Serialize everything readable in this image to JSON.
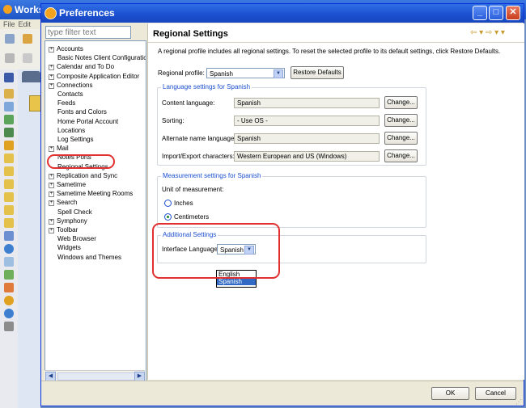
{
  "background_app": {
    "title": "Worksp",
    "menu": [
      "File",
      "Edit"
    ]
  },
  "window": {
    "title": "Preferences",
    "controls": [
      "_",
      "□",
      "✕"
    ]
  },
  "filter": {
    "placeholder": "type filter text"
  },
  "tree": [
    {
      "label": "Accounts",
      "expandable": true
    },
    {
      "label": "Basic Notes Client Configuratior",
      "expandable": false
    },
    {
      "label": "Calendar and To Do",
      "expandable": true
    },
    {
      "label": "Composite Application Editor",
      "expandable": true
    },
    {
      "label": "Connections",
      "expandable": true
    },
    {
      "label": "Contacts",
      "expandable": false
    },
    {
      "label": "Feeds",
      "expandable": false
    },
    {
      "label": "Fonts and Colors",
      "expandable": false
    },
    {
      "label": "Home Portal Account",
      "expandable": false
    },
    {
      "label": "Locations",
      "expandable": false
    },
    {
      "label": "Log Settings",
      "expandable": false
    },
    {
      "label": "Mail",
      "expandable": true
    },
    {
      "label": "Notes Ports",
      "expandable": false
    },
    {
      "label": "Regional Settings",
      "expandable": false
    },
    {
      "label": "Replication and Sync",
      "expandable": true
    },
    {
      "label": "Sametime",
      "expandable": true
    },
    {
      "label": "Sametime Meeting Rooms",
      "expandable": true
    },
    {
      "label": "Search",
      "expandable": true
    },
    {
      "label": "Spell Check",
      "expandable": false
    },
    {
      "label": "Symphony",
      "expandable": true
    },
    {
      "label": "Toolbar",
      "expandable": true
    },
    {
      "label": "Web Browser",
      "expandable": false
    },
    {
      "label": "Widgets",
      "expandable": false
    },
    {
      "label": "Windows and Themes",
      "expandable": false
    }
  ],
  "page": {
    "title": "Regional Settings",
    "nav_arrows": "⇦ ▾ ⇨ ▾ ▾",
    "description": "A regional profile includes all regional settings.  To reset the selected profile to its default settings, click Restore Defaults.",
    "profile_label": "Regional profile:",
    "profile_value": "Spanish",
    "restore_label": "Restore Defaults"
  },
  "language_group": {
    "title": "Language settings for Spanish",
    "change_label": "Change...",
    "rows": [
      {
        "label": "Content language:",
        "value": "Spanish"
      },
      {
        "label": "Sorting:",
        "value": "- Use OS -"
      },
      {
        "label": "Alternate name language:",
        "value": "Spanish"
      },
      {
        "label": "Import/Export characters:",
        "value": "Western European and US (Windows)"
      }
    ]
  },
  "measurement_group": {
    "title": "Measurement settings for Spanish",
    "unit_label": "Unit of measurement:",
    "options": [
      {
        "label": "Inches",
        "selected": false
      },
      {
        "label": "Centimeters",
        "selected": true
      }
    ]
  },
  "additional_group": {
    "title": "Additional Settings",
    "interface_label": "Interface Language",
    "interface_value": "Spanish",
    "dropdown_options": [
      {
        "label": "English",
        "selected": false
      },
      {
        "label": "Spanish",
        "selected": true
      }
    ]
  },
  "footer": {
    "ok_label": "OK",
    "cancel_label": "Cancel"
  },
  "colors": {
    "accent": "#1b4fcf",
    "highlight": "#e23030",
    "selection": "#316ac5"
  }
}
